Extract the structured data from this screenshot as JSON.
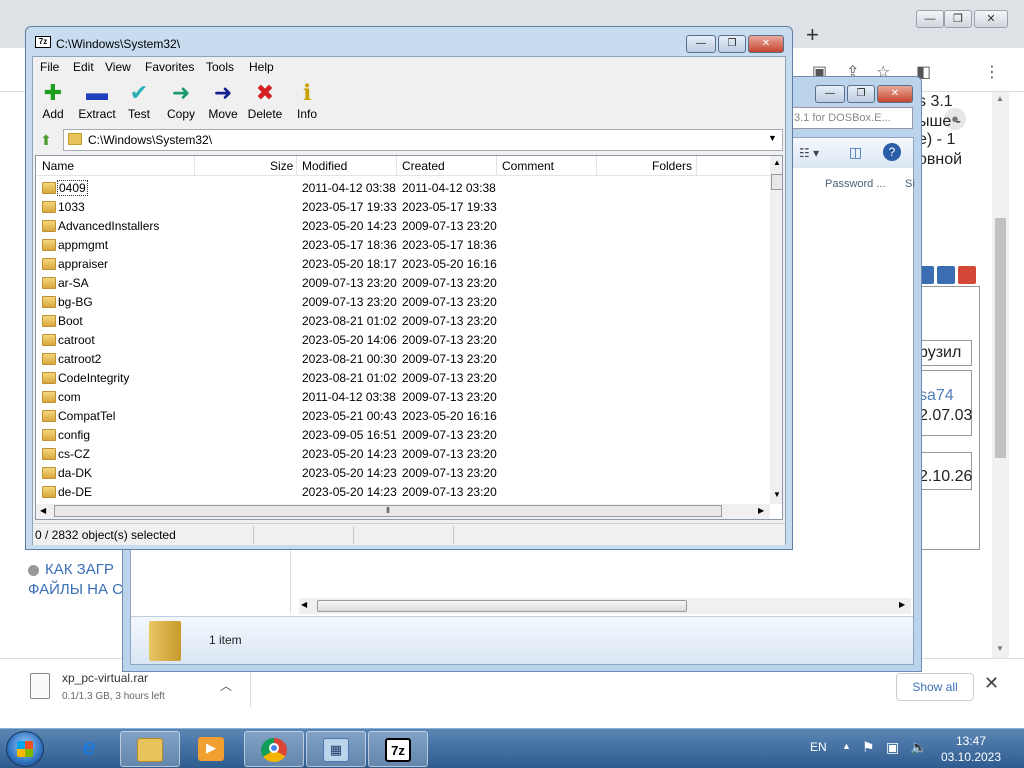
{
  "browser": {
    "page_lines": [
      "s 3.1",
      "ыше -",
      "е) - 1",
      "овной"
    ],
    "box_texts": [
      "рузил",
      "sa74",
      "2.07.03",
      "2.10.26"
    ],
    "bottom_links": [
      "КАК ЗАГР",
      "ФАЙЛЫ НА С"
    ],
    "download": {
      "filename": "xp_pc-virtual.rar",
      "status": "0.1/1.3 GB, 3 hours left",
      "show_all": "Show all"
    }
  },
  "explorer": {
    "search_placeholder": "3.1 for DOSBox.E...",
    "password_col": "Password ...",
    "size_col": "Si",
    "details": {
      "item_count": "1 item"
    }
  },
  "sevenzip": {
    "title": "C:\\Windows\\System32\\",
    "app_icon_text": "7z",
    "menu": [
      "File",
      "Edit",
      "View",
      "Favorites",
      "Tools",
      "Help"
    ],
    "toolbar": [
      {
        "label": "Add",
        "glyph": "✚",
        "color": "#1e9e1e"
      },
      {
        "label": "Extract",
        "glyph": "▬",
        "color": "#1f3fbf"
      },
      {
        "label": "Test",
        "glyph": "✔",
        "color": "#2bb0b8"
      },
      {
        "label": "Copy",
        "glyph": "➜",
        "color": "#1a9a6a"
      },
      {
        "label": "Move",
        "glyph": "➜",
        "color": "#15208f"
      },
      {
        "label": "Delete",
        "glyph": "✖",
        "color": "#d42020"
      },
      {
        "label": "Info",
        "glyph": "ℹ",
        "color": "#c8a000"
      }
    ],
    "address": "C:\\Windows\\System32\\",
    "columns": [
      "Name",
      "Size",
      "Modified",
      "Created",
      "Comment",
      "Folders"
    ],
    "rows": [
      {
        "name": "0409",
        "modified": "2011-04-12 03:38",
        "created": "2011-04-12 03:38"
      },
      {
        "name": "1033",
        "modified": "2023-05-17 19:33",
        "created": "2023-05-17 19:33"
      },
      {
        "name": "AdvancedInstallers",
        "modified": "2023-05-20 14:23",
        "created": "2009-07-13 23:20"
      },
      {
        "name": "appmgmt",
        "modified": "2023-05-17 18:36",
        "created": "2023-05-17 18:36"
      },
      {
        "name": "appraiser",
        "modified": "2023-05-20 18:17",
        "created": "2023-05-20 16:16"
      },
      {
        "name": "ar-SA",
        "modified": "2009-07-13 23:20",
        "created": "2009-07-13 23:20"
      },
      {
        "name": "bg-BG",
        "modified": "2009-07-13 23:20",
        "created": "2009-07-13 23:20"
      },
      {
        "name": "Boot",
        "modified": "2023-08-21 01:02",
        "created": "2009-07-13 23:20"
      },
      {
        "name": "catroot",
        "modified": "2023-05-20 14:06",
        "created": "2009-07-13 23:20"
      },
      {
        "name": "catroot2",
        "modified": "2023-08-21 00:30",
        "created": "2009-07-13 23:20"
      },
      {
        "name": "CodeIntegrity",
        "modified": "2023-08-21 01:02",
        "created": "2009-07-13 23:20"
      },
      {
        "name": "com",
        "modified": "2011-04-12 03:38",
        "created": "2009-07-13 23:20"
      },
      {
        "name": "CompatTel",
        "modified": "2023-05-21 00:43",
        "created": "2023-05-20 16:16"
      },
      {
        "name": "config",
        "modified": "2023-09-05 16:51",
        "created": "2009-07-13 23:20"
      },
      {
        "name": "cs-CZ",
        "modified": "2023-05-20 14:23",
        "created": "2009-07-13 23:20"
      },
      {
        "name": "da-DK",
        "modified": "2023-05-20 14:23",
        "created": "2009-07-13 23:20"
      },
      {
        "name": "de-DE",
        "modified": "2023-05-20 14:23",
        "created": "2009-07-13 23:20"
      }
    ],
    "status": "0 / 2832 object(s) selected"
  },
  "taskbar": {
    "lang": "EN",
    "time": "13:47",
    "date": "03.10.2023",
    "apps": [
      {
        "name": "ie",
        "glyph": "e",
        "color": "#1e78d6"
      },
      {
        "name": "explorer",
        "glyph": "▤",
        "color": "#d9a73c"
      },
      {
        "name": "media-player",
        "glyph": "▶",
        "color": "#e07a1a"
      },
      {
        "name": "chrome",
        "glyph": "◉",
        "color": "#db4437"
      },
      {
        "name": "rdp",
        "glyph": "▦",
        "color": "#4a78b5"
      },
      {
        "name": "7zip",
        "glyph": "7z",
        "color": "#000000"
      }
    ]
  }
}
